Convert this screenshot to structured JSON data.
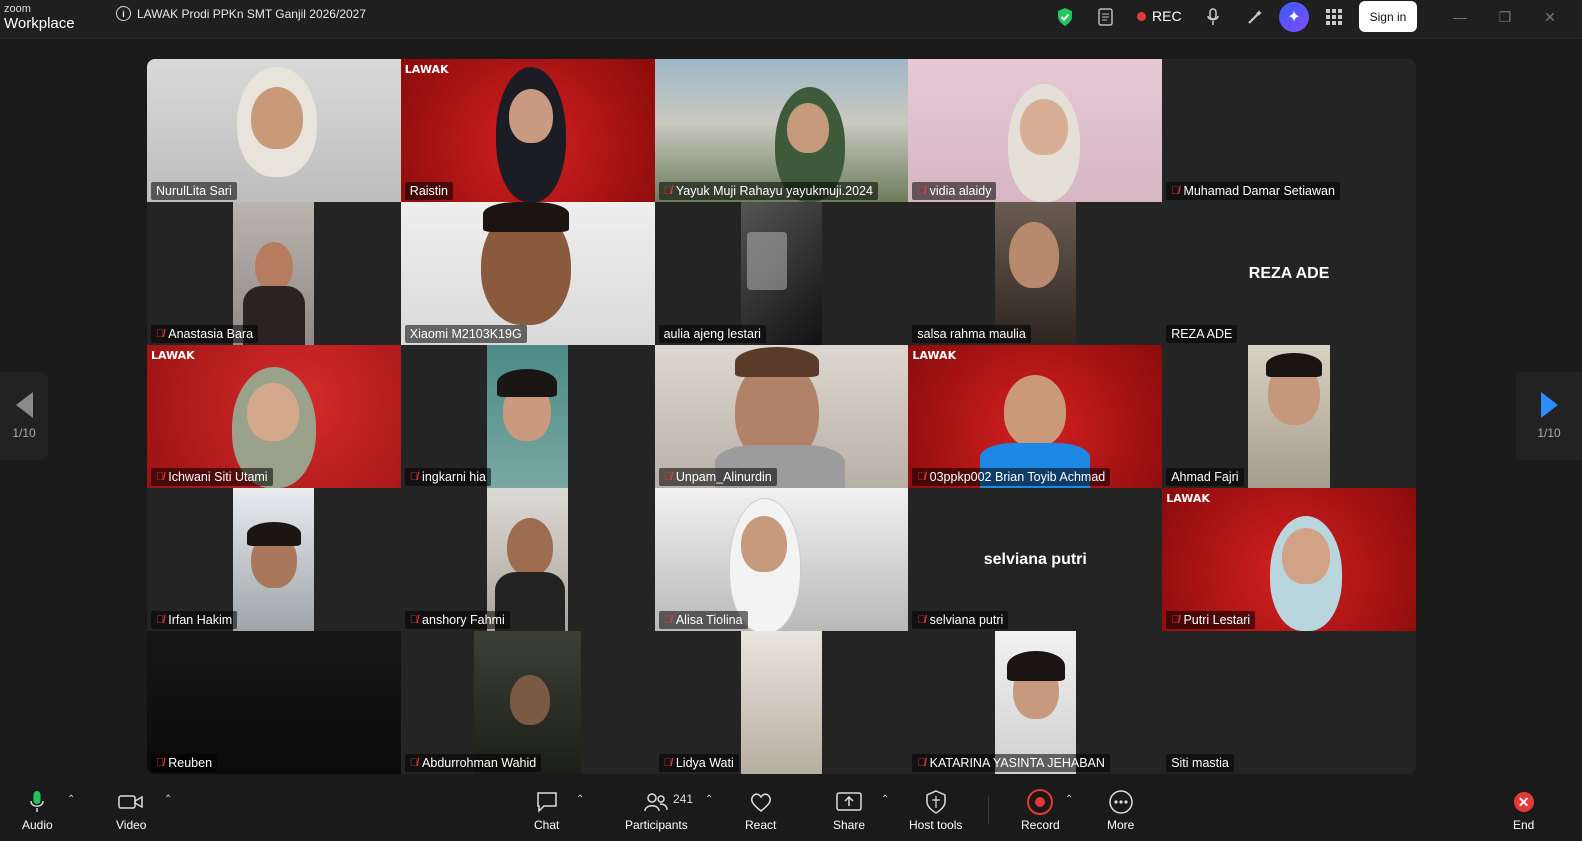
{
  "app": {
    "brand_small": "zoom",
    "brand_big": "Workplace"
  },
  "meeting": {
    "title": "LAWAK Prodi PPKn SMT Ganjil 2026/2027"
  },
  "topbar": {
    "rec_label": "REC",
    "signin_label": "Sign in"
  },
  "pager": {
    "left_text": "1/10",
    "right_text": "1/10"
  },
  "tiles": [
    {
      "name": "NurulLita Sari",
      "muted": false
    },
    {
      "name": "Raistin",
      "muted": false
    },
    {
      "name": "Yayuk Muji Rahayu yayukmuji.2024",
      "muted": true
    },
    {
      "name": "vidia alaidy",
      "muted": true
    },
    {
      "name": "Muhamad Damar Setiawan",
      "muted": true
    },
    {
      "name": "Anastasia Bara",
      "muted": true
    },
    {
      "name": "Xiaomi M2103K19G",
      "muted": false
    },
    {
      "name": "aulia ajeng lestari",
      "muted": false
    },
    {
      "name": "salsa rahma maulia",
      "muted": false
    },
    {
      "name": "REZA ADE",
      "muted": false
    },
    {
      "name": "Ichwani Siti Utami",
      "muted": true
    },
    {
      "name": "ingkarni hia",
      "muted": true
    },
    {
      "name": "Unpam_Alinurdin",
      "muted": true
    },
    {
      "name": "03ppkp002 Brian Toyib Achmad",
      "muted": true
    },
    {
      "name": "Ahmad Fajri",
      "muted": false
    },
    {
      "name": "Irfan Hakim",
      "muted": true
    },
    {
      "name": "anshory Fahmi",
      "muted": true
    },
    {
      "name": "Alisa Tiolina",
      "muted": true
    },
    {
      "name": "selviana putri",
      "muted": true
    },
    {
      "name": "Putri Lestari",
      "muted": true
    },
    {
      "name": "Reuben",
      "muted": true
    },
    {
      "name": "Abdurrohman Wahid",
      "muted": true
    },
    {
      "name": "Lidya Wati",
      "muted": true
    },
    {
      "name": "KATARINA YASINTA JEHABAN",
      "muted": true
    },
    {
      "name": "Siti mastia",
      "muted": false
    }
  ],
  "banner_text": "LAWAK",
  "toolbar": {
    "audio": "Audio",
    "video": "Video",
    "chat": "Chat",
    "participants": "Participants",
    "participants_count": "241",
    "react": "React",
    "share": "Share",
    "host_tools": "Host tools",
    "record": "Record",
    "more": "More",
    "end": "End"
  },
  "colors": {
    "accent": "#2d8cff",
    "active_border": "#2ecc71",
    "danger": "#e53935"
  }
}
